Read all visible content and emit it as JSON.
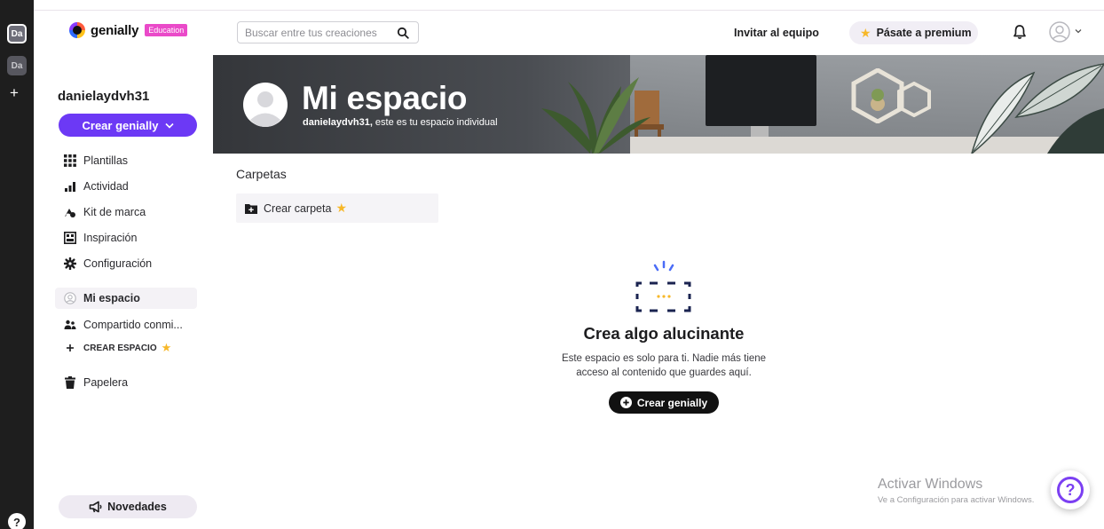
{
  "rail": {
    "workspaces": [
      "Da",
      "Da"
    ],
    "add_label": "+",
    "help_label": "?"
  },
  "header": {
    "logo_text": "genially",
    "logo_badge": "Education",
    "search_placeholder": "Buscar entre tus creaciones",
    "invite_label": "Invitar al equipo",
    "premium_label": "Pásate a premium"
  },
  "sidebar": {
    "username": "danielaydvh31",
    "create_label": "Crear genially",
    "items": [
      {
        "label": "Plantillas",
        "icon": "grid-icon"
      },
      {
        "label": "Actividad",
        "icon": "bar-chart-icon"
      },
      {
        "label": "Kit de marca",
        "icon": "brand-kit-icon"
      },
      {
        "label": "Inspiración",
        "icon": "inspiration-icon"
      },
      {
        "label": "Configuración",
        "icon": "gear-icon"
      },
      {
        "label": "Mi espacio",
        "icon": "user-circle-icon"
      },
      {
        "label": "Compartido conmi...",
        "icon": "people-icon"
      },
      {
        "label": "CREAR ESPACIO",
        "icon": "plus-icon"
      },
      {
        "label": "Papelera",
        "icon": "trash-icon"
      }
    ],
    "news_label": "Novedades"
  },
  "banner": {
    "title": "Mi espacio",
    "subtitle_user": "danielaydvh31,",
    "subtitle_rest": " este es tu espacio individual"
  },
  "main": {
    "folders_title": "Carpetas",
    "create_folder_label": "Crear carpeta",
    "empty_title": "Crea algo alucinante",
    "empty_line1": "Este espacio es solo para ti. Nadie más tiene",
    "empty_line2": "acceso al contenido que guardes aquí.",
    "empty_button": "Crear genially"
  },
  "watermark": {
    "line1": "Activar Windows",
    "line2": "Ve a Configuración para activar Windows."
  },
  "colors": {
    "accent": "#6c39f5",
    "star": "#f7b829",
    "badge": "#ea4ac9",
    "rail": "#1e1e1e"
  }
}
